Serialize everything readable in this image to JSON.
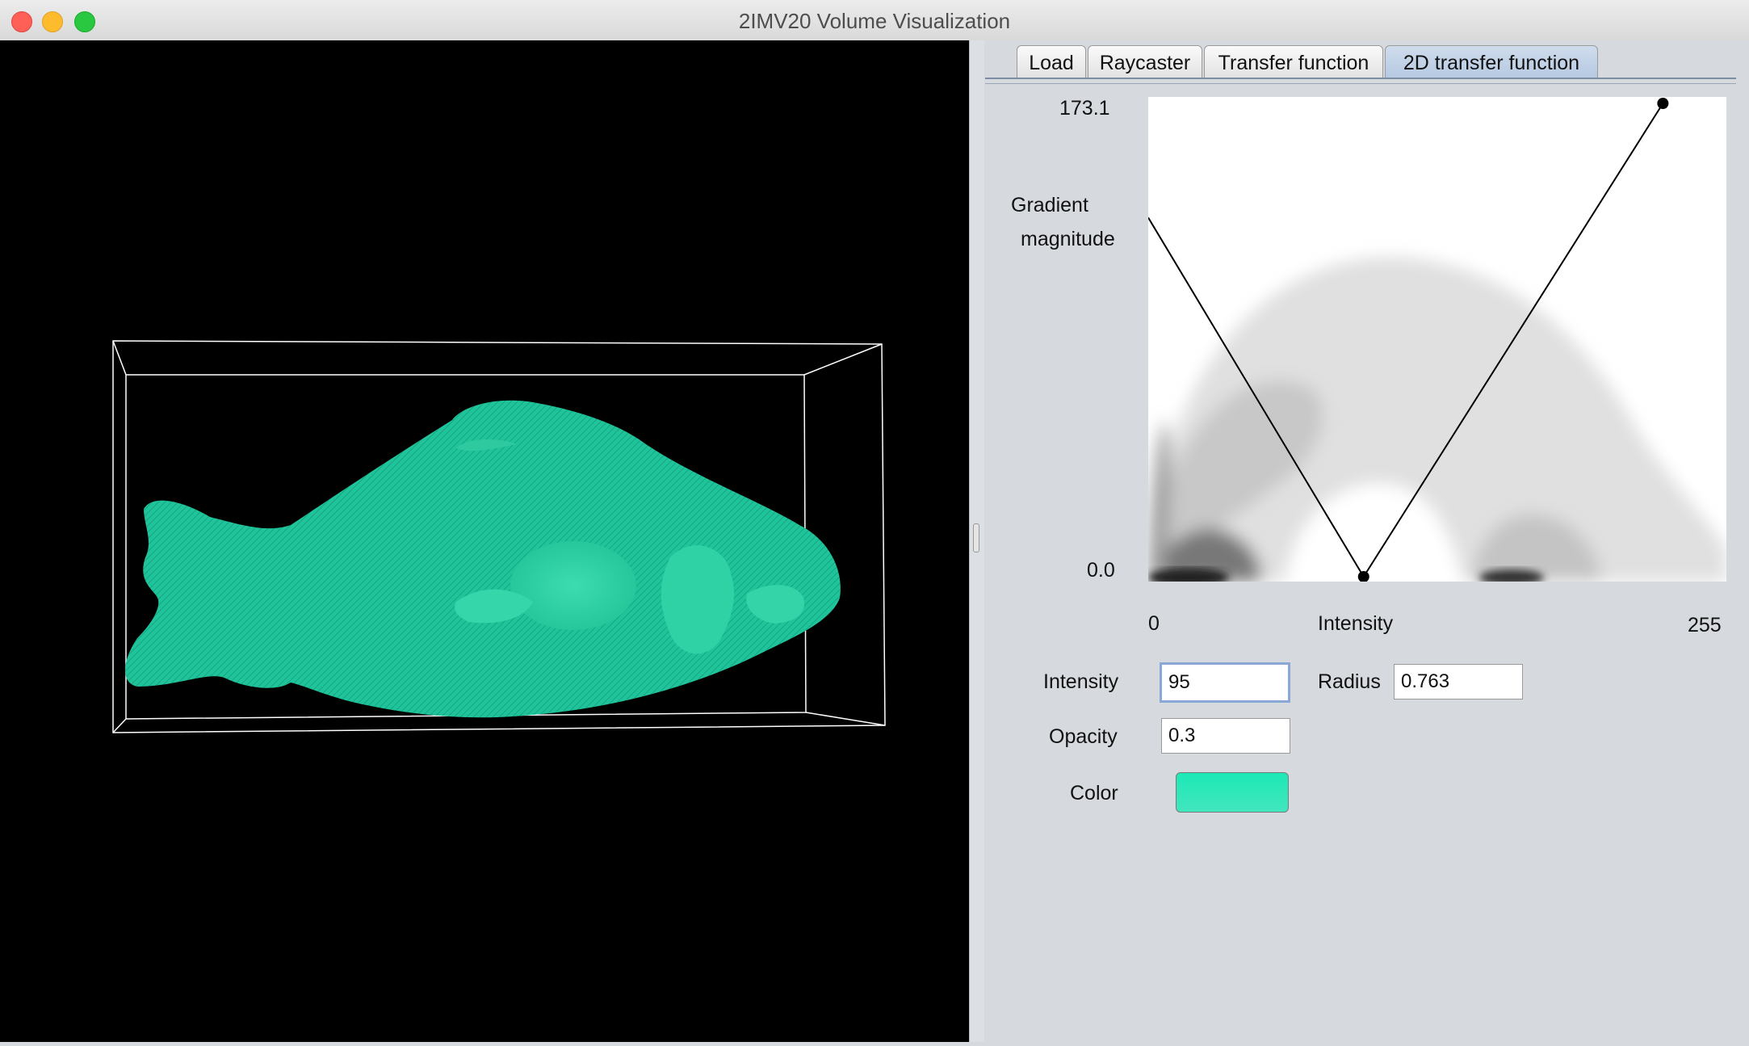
{
  "window": {
    "title": "2IMV20 Volume Visualization"
  },
  "tabs": [
    {
      "label": "Load"
    },
    {
      "label": "Raycaster"
    },
    {
      "label": "Transfer function"
    },
    {
      "label": "2D transfer function"
    }
  ],
  "active_tab": "2D transfer function",
  "plot": {
    "y_max_label": "173.1",
    "y_min_label": "0.0",
    "y_label_line1": "Gradient",
    "y_label_line2": "magnitude",
    "x_min_label": "0",
    "x_label": "Intensity",
    "x_max_label": "255"
  },
  "chart_data": {
    "type": "scatter",
    "title": "",
    "xlabel": "Intensity",
    "ylabel": "Gradient magnitude",
    "xlim": [
      0,
      255
    ],
    "ylim": [
      0,
      173.1
    ],
    "triangle_widget": {
      "apex_intensity": 95,
      "apex_gradient": 0,
      "control_point_intensity": 227,
      "control_point_gradient": 173.1,
      "left_edge_top_gradient": 130
    }
  },
  "controls": {
    "intensity_label": "Intensity",
    "intensity_value": "95",
    "radius_label": "Radius",
    "radius_value": "0.763",
    "opacity_label": "Opacity",
    "opacity_value": "0.3",
    "color_label": "Color",
    "color_value": "#1de9b6"
  },
  "render_colors": {
    "fish": "#1fc49a",
    "background": "#000000",
    "box": "#ffffff"
  }
}
